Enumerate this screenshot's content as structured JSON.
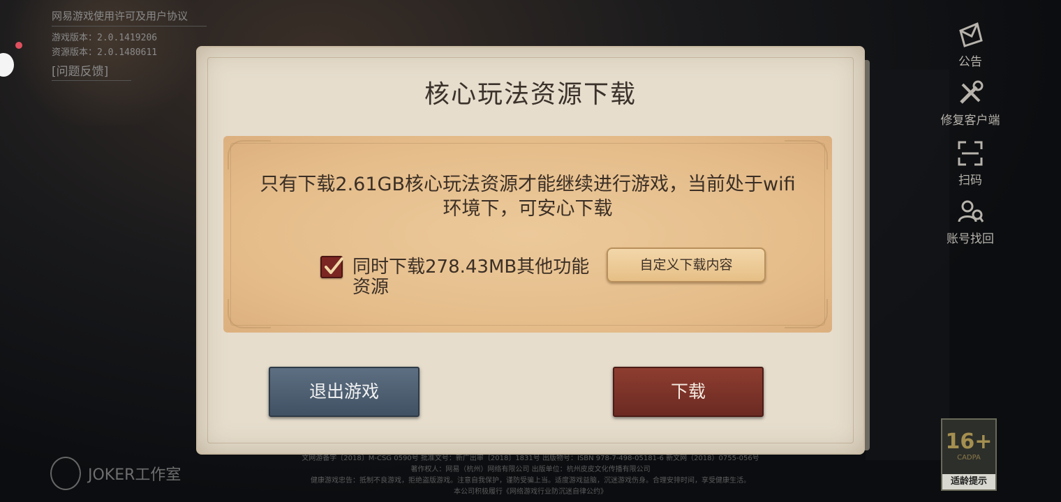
{
  "info": {
    "agreement_link": "网易游戏使用许可及用户协议",
    "game_version": "游戏版本：2.0.1419206",
    "resource_version": "资源版本：2.0.1480611",
    "feedback": "[问题反馈]"
  },
  "right_menu": {
    "items": [
      {
        "label": "公告",
        "icon": "announcement-icon"
      },
      {
        "label": "修复客户端",
        "icon": "wrench-tools-icon"
      },
      {
        "label": "扫码",
        "icon": "scan-icon"
      },
      {
        "label": "账号找回",
        "icon": "account-recovery-icon"
      }
    ]
  },
  "dialog": {
    "title": "核心玩法资源下载",
    "message": "只有下载2.61GB核心玩法资源才能继续进行游戏，当前处于wifi环境下，可安心下载",
    "extra_checkbox": {
      "checked": true,
      "label": "同时下载278.43MB其他功能资源"
    },
    "custom_button": "自定义下载内容",
    "exit_button": "退出游戏",
    "download_button": "下载"
  },
  "footer": {
    "studio": "JOKER工作室",
    "lines": [
      "文网游备字〔2018〕M-CSG 0590号  批准文号：新广出审〔2018〕1831号  出版物号：ISBN 978-7-498-05181-6  新文网（2018）0755-056号",
      "著作权人：网易（杭州）网络有限公司    出版单位：杭州皮皮文化传播有限公司",
      "健康游戏忠告：抵制不良游戏，拒绝盗版游戏。注意自我保护，谨防受骗上当。适度游戏益脑，沉迷游戏伤身。合理安排时间，享受健康生活。",
      "本公司积极履行《网络游戏行业防沉迷自律公约》"
    ],
    "age_rating": "16+",
    "age_org": "CADPA",
    "age_tip": "适龄提示"
  },
  "colors": {
    "dialog_bg": "#e6ddcd",
    "panel_bg": "#e5bd8b",
    "exit_button": "#4f6073",
    "download_button": "#7c3328",
    "checkbox": "#7b2622"
  }
}
